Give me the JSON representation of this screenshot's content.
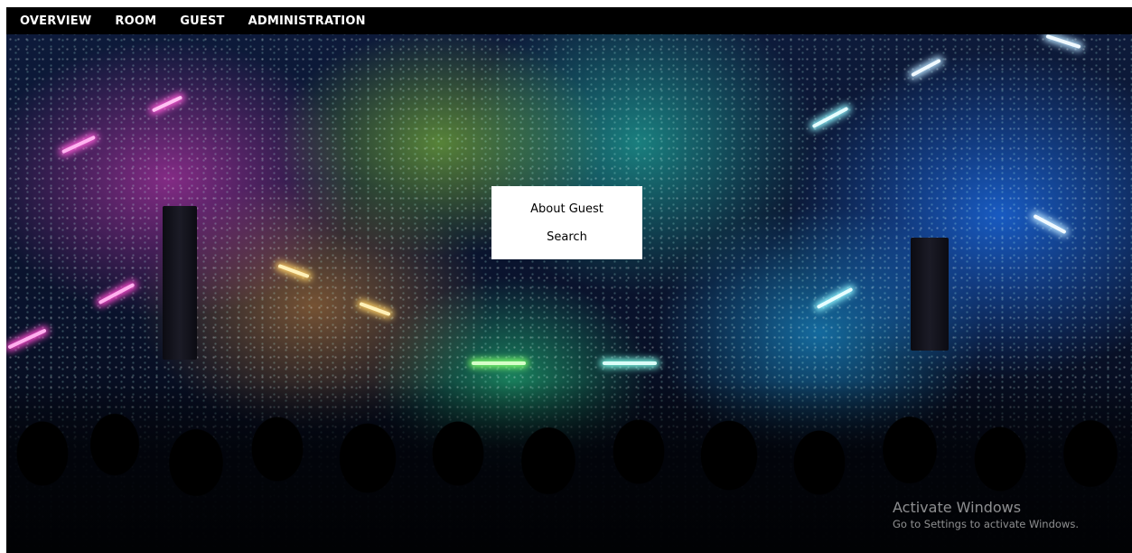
{
  "nav": {
    "items": [
      {
        "label": "OVERVIEW"
      },
      {
        "label": "ROOM"
      },
      {
        "label": "GUEST"
      },
      {
        "label": "ADMINISTRATION"
      }
    ]
  },
  "menu": {
    "about_label": "About Guest",
    "search_label": "Search"
  },
  "watermark": {
    "title": "Activate Windows",
    "subtitle": "Go to Settings to activate Windows."
  },
  "colors": {
    "navbar": "#000000",
    "nav_text": "#ffffff",
    "menu_background": "#ffffff",
    "menu_text": "#000000"
  },
  "background_icon": "concert-stage-photo"
}
